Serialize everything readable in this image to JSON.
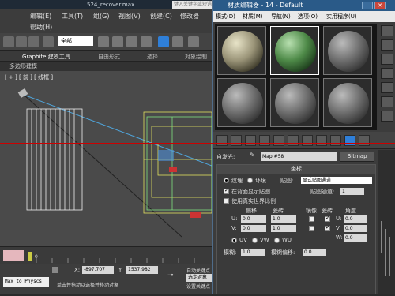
{
  "app": {
    "title": "524_recover.max",
    "search_placeholder": "键入关键字或短语"
  },
  "menus": {
    "row1": [
      "编辑(E)",
      "工具(T)",
      "组(G)",
      "视图(V)",
      "创建(C)",
      "修改器"
    ],
    "row2": [
      "帮助(H)"
    ]
  },
  "toolbar": {
    "selection_filter": "全部"
  },
  "ribbon": {
    "tabs": [
      "Graphite 建模工具",
      "自由形式",
      "选择",
      "对象绘制"
    ],
    "subtab": "多边形建模"
  },
  "viewport": {
    "label": "[ + ] [ 前 ] [ 线框 ]"
  },
  "timeline": {
    "frame": "0"
  },
  "status": {
    "script_label": "Max to Physcs",
    "x_label": "X:",
    "x_value": "-897.707",
    "y_label": "Y:",
    "y_value": "1537.982",
    "auto_key": "自动关键点",
    "set_key": "设置关键点",
    "selected": "选定对象",
    "prompt": "单击并拖动以选择并移动对象"
  },
  "material_editor": {
    "title": "材质编辑器 - 14 - Default",
    "menu": [
      "模式(D)",
      "材质(M)",
      "导航(N)",
      "选项(O)",
      "实用程序(U)"
    ],
    "map_label": "自发光:",
    "map_name": "Map #58",
    "map_type": "Bitmap",
    "rollout_title": "坐标",
    "texture_label": "纹理",
    "environ_label": "环境",
    "mapping_label": "贴图:",
    "mapping_value": "显式贴图通道",
    "show_map_label": "在背面显示贴图",
    "map_channel_label": "贴图通道:",
    "map_channel_value": "1",
    "real_world_label": "使用真实世界比例",
    "col_offset": "偏移",
    "col_tiling": "瓷砖",
    "col_mirror": "镜像",
    "col_tile": "瓷砖",
    "col_angle": "角度",
    "u_label": "U:",
    "v_label": "V:",
    "w_label": "W:",
    "u_offset": "0.0",
    "v_offset": "0.0",
    "u_tiling": "1.0",
    "v_tiling": "1.0",
    "u_angle": "0.0",
    "v_angle": "0.0",
    "w_angle": "0.0",
    "uv": "UV",
    "vw": "VW",
    "wu": "WU",
    "blur_label": "模糊:",
    "blur_value": "1.0",
    "blur_offset_label": "模糊偏移:",
    "blur_offset_value": "0.0"
  }
}
